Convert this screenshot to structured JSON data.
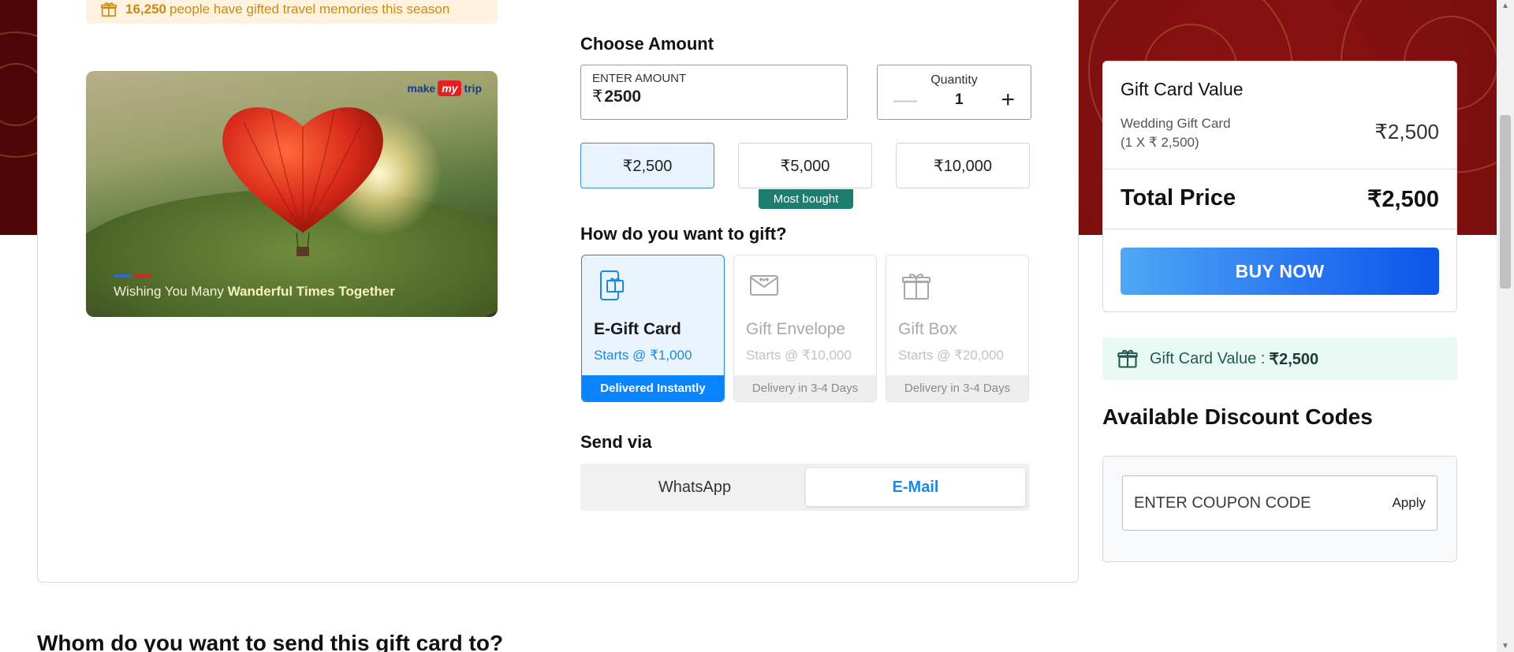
{
  "banner": {
    "count": "16,250",
    "text": "people have gifted travel memories this season"
  },
  "gift_image": {
    "logo_make": "make",
    "logo_my": "my",
    "logo_trip": "trip",
    "caption_prefix": "Wishing You Many",
    "caption_bold": "Wanderful Times Together"
  },
  "amount": {
    "heading": "Choose Amount",
    "field_label": "ENTER AMOUNT",
    "currency": "₹",
    "value": "2500",
    "quantity_label": "Quantity",
    "quantity_value": "1",
    "minus": "—",
    "plus": "+",
    "presets": [
      "₹2,500",
      "₹5,000",
      "₹10,000"
    ],
    "most_bought": "Most bought"
  },
  "gift_method": {
    "heading": "How do you want to gift?",
    "options": [
      {
        "title": "E-Gift Card",
        "sub": "Starts @ ₹1,000",
        "foot": "Delivered Instantly",
        "icon": "phone-gift-icon"
      },
      {
        "title": "Gift Envelope",
        "sub": "Starts @ ₹10,000",
        "foot": "Delivery in 3-4 Days",
        "icon": "envelope-icon"
      },
      {
        "title": "Gift Box",
        "sub": "Starts @ ₹20,000",
        "foot": "Delivery in 3-4 Days",
        "icon": "gift-box-icon"
      }
    ]
  },
  "send_via": {
    "heading": "Send via",
    "options": [
      "WhatsApp",
      "E-Mail"
    ],
    "selected": "E-Mail"
  },
  "price_card": {
    "heading": "Gift Card Value",
    "item_name": "Wedding Gift Card",
    "item_detail": "(1 X ₹ 2,500)",
    "item_value": "₹2,500",
    "total_label": "Total Price",
    "total_value": "₹2,500",
    "buy_label": "BUY NOW"
  },
  "gcv_strip": {
    "label": "Gift Card Value :",
    "value": "₹2,500"
  },
  "discount": {
    "heading": "Available Discount Codes",
    "placeholder": "ENTER COUPON CODE",
    "apply": "Apply"
  },
  "recipient": {
    "heading": "Whom do you want to send this gift card to?"
  },
  "colors": {
    "accent": "#1a88e6",
    "buy_start": "#4fa7f5",
    "buy_end": "#0b55e8",
    "badge": "#1f7d6f",
    "banner_text": "#c98a1a"
  }
}
